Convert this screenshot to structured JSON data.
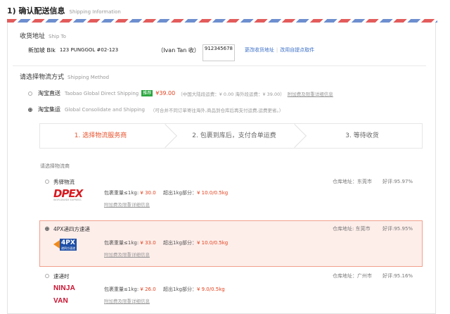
{
  "header": {
    "title": "1) 确认配送信息",
    "subtitle": "Shipping Information"
  },
  "ship_to": {
    "title": "收货地址",
    "subtitle": "Ship To",
    "country": "新加坡 Blk",
    "street": "123 PUNGGOL #02-123",
    "recipient": "（Ivan Tan 收）",
    "phone": "912345678",
    "change_link": "更改收货地址",
    "self_pickup_link": "改用自提点取件"
  },
  "shipping_method": {
    "title": "请选择物流方式",
    "subtitle": "Shipping Method",
    "options": [
      {
        "label": "淘宝直送",
        "en": "Taobao Global Direct Shipping",
        "badge": "推荐",
        "price": "¥39.00",
        "note": "（中国大陆段运费：¥ 0.00 海外段运费：¥ 39.00）",
        "fee_link": "附加费及限重详细信息",
        "selected": false
      },
      {
        "label": "淘宝集运",
        "en": "Global Consolidate and Shipping",
        "note": "（可合并不同订单寄往海外,商品到仓库后再支付运费,运费更省。）",
        "selected": true
      }
    ]
  },
  "steps": [
    "1. 选择物流服务商",
    "2. 包裹到库后，支付合单运费",
    "3. 等待收货"
  ],
  "carrier_section": {
    "label": "请选择物流商"
  },
  "carriers": [
    {
      "name": "秀驿物流",
      "warehouse": "仓库地址：东莞市",
      "rating": "好评:95.97%",
      "logo_text": "DPEX",
      "logo_sub": "WORLDWIDE EXPRESS",
      "price1_label": "包裹重量≤1kg: ",
      "price1": "¥ 30.0",
      "price2_label": "超出1kg部分：",
      "price2": "¥ 10.0/0.5kg",
      "fee_link": "附加费及限重详细信息",
      "selected": false
    },
    {
      "name": "4PX递四方速递",
      "warehouse": "仓库地址: 东莞市",
      "rating": "好评:95.95%",
      "logo_text": "4PX",
      "logo_sub": "递四方速递",
      "price1_label": "包裹重量≤1kg: ",
      "price1": "¥ 33.0",
      "price2_label": "超出1kg部分：",
      "price2": "¥ 10.0/0.5kg",
      "fee_link": "附加费及限重详细信息",
      "selected": true
    },
    {
      "name": "速递时",
      "warehouse": "仓库地址：广州市",
      "rating": "好评:95.16%",
      "logo_text": "NINJA VAN",
      "price1_label": "包裹重量≤1kg: ",
      "price1": "¥ 26.0",
      "price2_label": "超出1kg部分：",
      "price2": "¥ 9.0/0.5kg",
      "fee_link": "附加费及限重详细信息",
      "selected": false
    }
  ],
  "colors": {
    "accent": "#e2421f",
    "badge": "#2aa63f",
    "link": "#3a6fc7",
    "selected_bg": "#fdeeea"
  }
}
